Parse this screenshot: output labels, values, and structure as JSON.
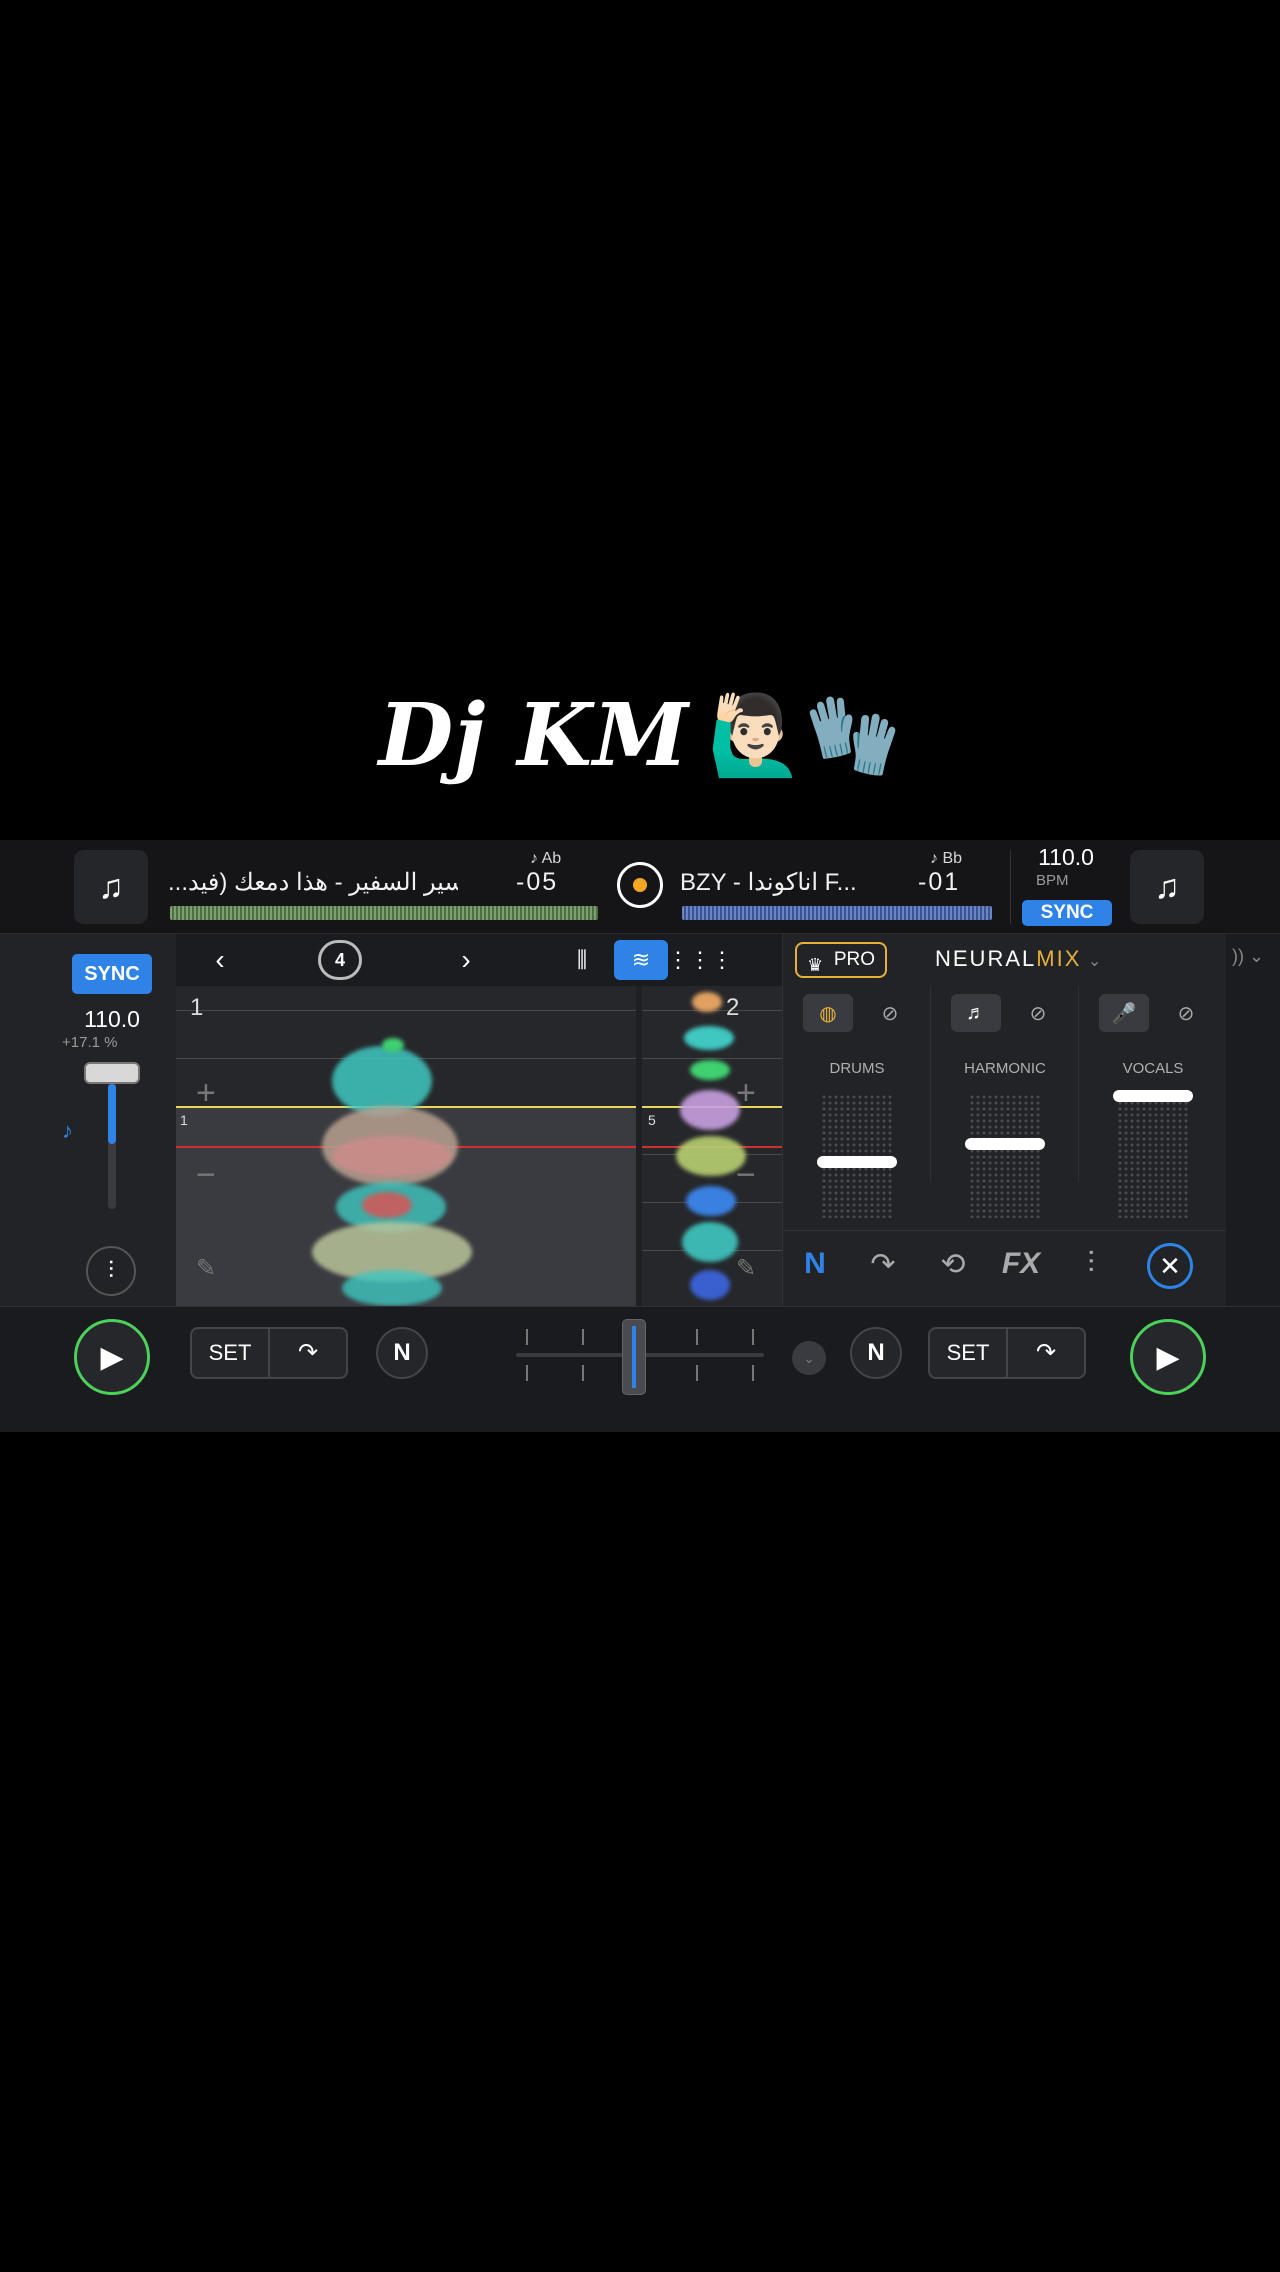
{
  "overlay": {
    "title": "Dj KM",
    "emoji": "🙋🏻‍♂️🧤"
  },
  "deck_a": {
    "title": "...يسير السفير - هذا دمعك (فيد",
    "time": "-05",
    "key": "♪ Ab",
    "bpm": "110.0",
    "pitch": "+17.1 %",
    "sync": "SYNC",
    "deck_number": "1",
    "cue_label": "1"
  },
  "deck_b": {
    "title": "BZY - اناكوندا  F...",
    "time": "-01",
    "key": "♪ Bb",
    "bpm": "110.0",
    "bpm_label": "BPM",
    "sync": "SYNC",
    "deck_number": "2",
    "cue_label": "5"
  },
  "toolbar": {
    "loop_value": "4"
  },
  "neural_mix": {
    "pro_label": "PRO",
    "title_white": "NEURAL",
    "title_gold": "MIX",
    "stems": [
      {
        "label": "DRUMS",
        "level": 0.45
      },
      {
        "label": "HARMONIC",
        "level": 0.6
      },
      {
        "label": "VOCALS",
        "level": 1.0
      }
    ]
  },
  "bottom": {
    "set_label": "SET",
    "crossfader_value": 0.47
  },
  "colors": {
    "accent": "#2f83e6",
    "gold": "#e6b03a",
    "play_green": "#4cd05a"
  }
}
